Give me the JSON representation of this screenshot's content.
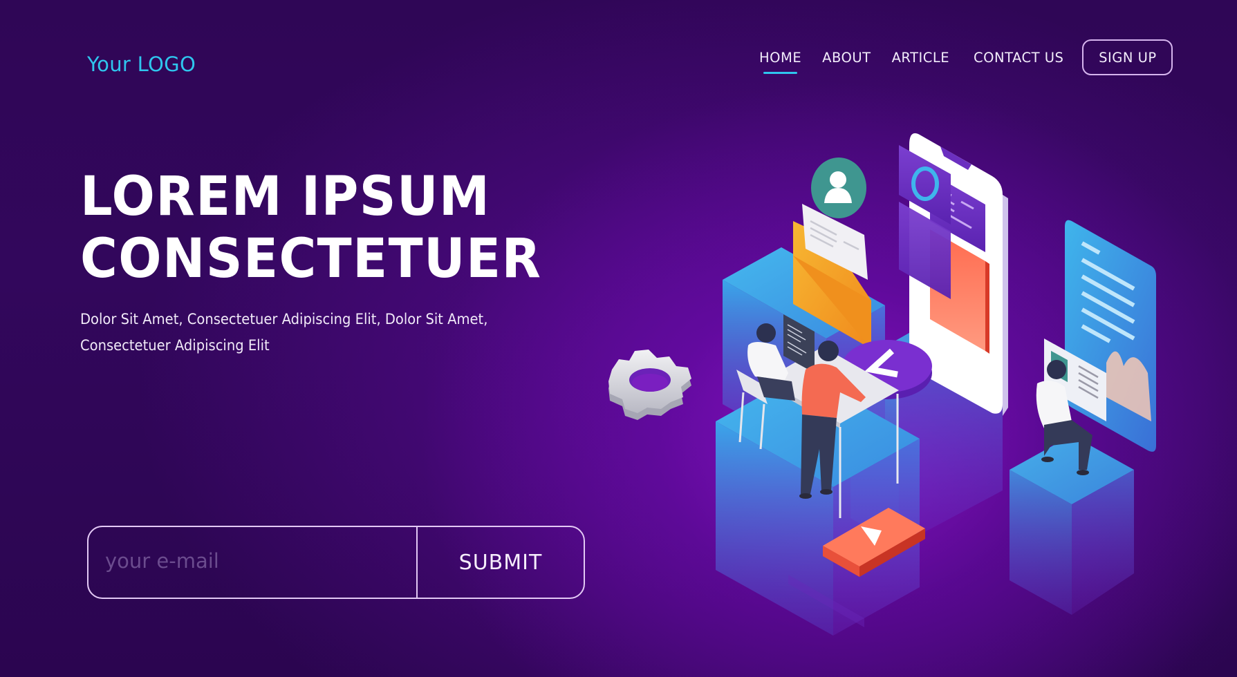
{
  "header": {
    "logo": "Your LOGO",
    "nav": [
      {
        "label": "HOME",
        "active": true
      },
      {
        "label": "ABOUT",
        "active": false
      },
      {
        "label": "ARTICLE",
        "active": false
      },
      {
        "label": "CONTACT US",
        "active": false
      }
    ],
    "signup_label": "SIGN UP"
  },
  "hero": {
    "title_line1": "LOREM IPSUM",
    "title_line2": "CONSECTETUER",
    "subtitle_line1": "Dolor Sit Amet, Consectetuer Adipiscing Elit, Dolor Sit Amet,",
    "subtitle_line2": "Consectetuer Adipiscing Elit"
  },
  "subscribe": {
    "email_value": "",
    "email_placeholder": "your e-mail",
    "submit_label": "SUBMIT"
  },
  "illustration": {
    "description": "isometric teamwork app development",
    "icons": [
      "user-avatar-icon",
      "envelope-icon",
      "gear-icon",
      "smartphone-icon",
      "document-panel-icon",
      "play-button-icon",
      "chevron-left-icon",
      "ring-icon"
    ]
  },
  "colors": {
    "accent": "#2fc6ee",
    "background_dark": "#2f0656",
    "background_glow": "#7a0fc0",
    "button_border": "#d6b5ee",
    "play_button": "#f2644a",
    "envelope": "#f5a623"
  }
}
